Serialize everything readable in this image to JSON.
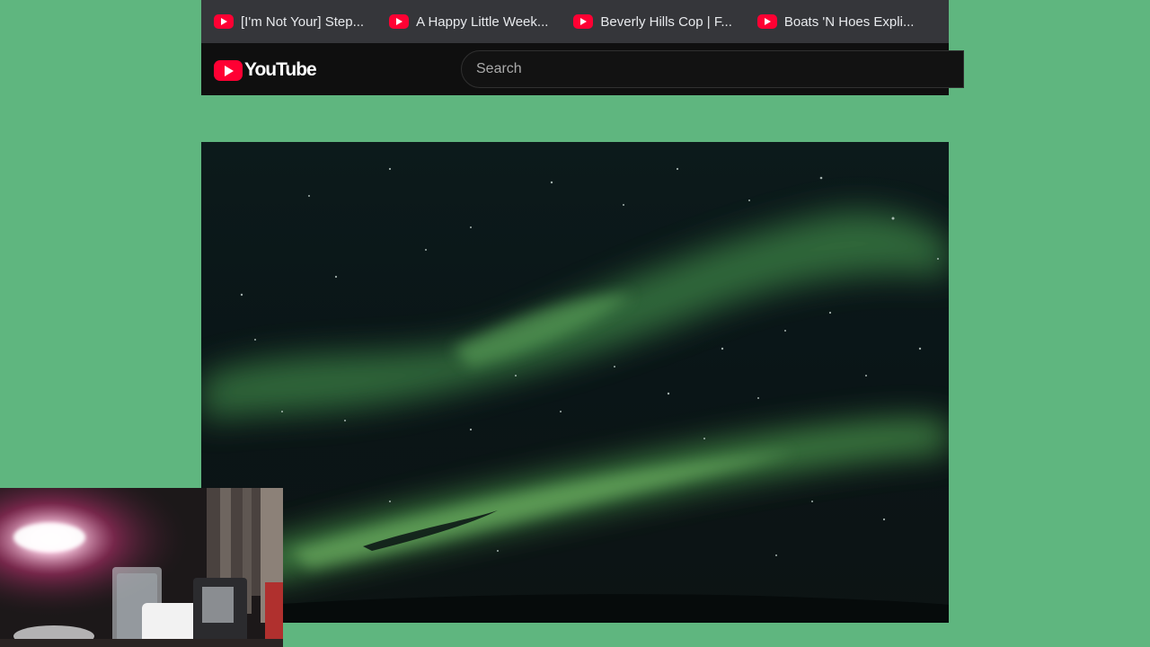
{
  "bookmarks": [
    {
      "label": "[I'm Not Your] Step...",
      "icon": "youtube-icon"
    },
    {
      "label": "A Happy Little Week...",
      "icon": "youtube-icon"
    },
    {
      "label": "Beverly Hills Cop | F...",
      "icon": "youtube-icon"
    },
    {
      "label": "Boats 'N Hoes Expli...",
      "icon": "youtube-icon"
    }
  ],
  "header": {
    "logo_text": "YouTube",
    "search_placeholder": "Search"
  },
  "video": {
    "scene": "aurora-night-sky"
  },
  "webcam": {
    "scene": "webcam-overlay"
  },
  "colors": {
    "page_background": "#5fb67f",
    "bookmarks_bar": "#35363a",
    "header_background": "#0f0f0f",
    "brand_red": "#ff0033"
  }
}
